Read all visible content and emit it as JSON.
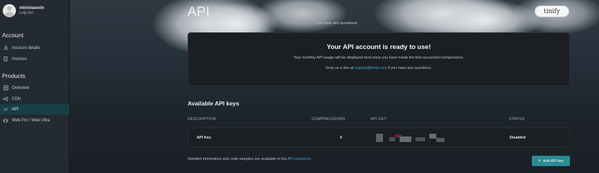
{
  "user": {
    "name": "minixiaoxin",
    "logout": "Log out"
  },
  "sidebar": {
    "account_title": "Account",
    "account_items": [
      {
        "label": "Account details",
        "icon": "person-icon"
      },
      {
        "label": "Invoices",
        "icon": "document-icon"
      }
    ],
    "products_title": "Products",
    "product_items": [
      {
        "label": "Overview",
        "icon": "grid-icon"
      },
      {
        "label": "CDN",
        "icon": "cdn-icon"
      },
      {
        "label": "API",
        "icon": "swap-arrows-icon",
        "active": true
      },
      {
        "label": "Web Pro / Web Ultra",
        "icon": "crown-icon"
      }
    ]
  },
  "header": {
    "title": "API",
    "note": "you have any questions!",
    "logo": "tinify"
  },
  "ready_card": {
    "title": "Your API account is ready to use!",
    "line1": "Your monthly API usage will be displayed here once you have made the first successful compression.",
    "line2_before": "Drop us a line at ",
    "line2_link": "support@tinify.com",
    "line2_after": " if you have any questions."
  },
  "keys": {
    "title": "Available API keys",
    "columns": [
      "DESCRIPTION",
      "COMPRESSIONS",
      "API KEY",
      "STATUS"
    ],
    "rows": [
      {
        "description": "API Key",
        "compressions": "0",
        "api_key_redacted": "KEY",
        "status": "Disabled"
      }
    ],
    "more_icon": "vertical-dots-icon"
  },
  "footer": {
    "text_before": "Detailed information and code samples are available in the ",
    "link": "API reference",
    "text_after": ".",
    "add_button": "Add API key"
  },
  "colors": {
    "accent": "#2c8a95",
    "link": "#39a9dc",
    "active_nav": "#173f45"
  }
}
